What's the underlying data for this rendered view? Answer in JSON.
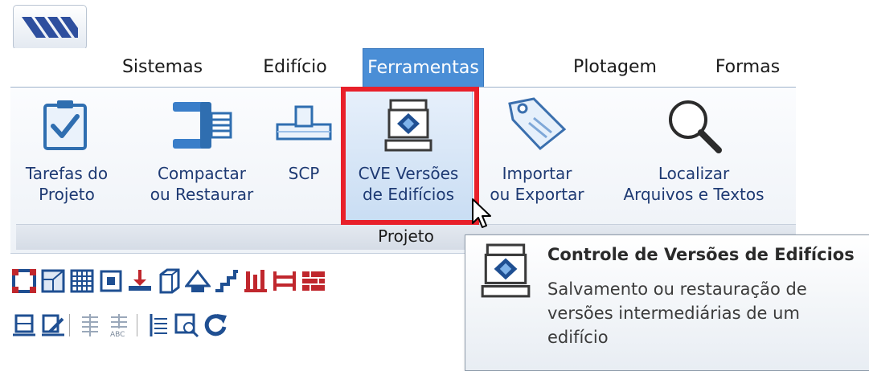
{
  "app_button": {
    "icon": "application-logo-icon"
  },
  "tabs": [
    {
      "label": "Sistemas",
      "active": false
    },
    {
      "label": "Edifício",
      "active": false
    },
    {
      "label": "Ferramentas",
      "active": true
    },
    {
      "label": "Plotagem",
      "active": false
    },
    {
      "label": "Formas",
      "active": false
    }
  ],
  "ribbon": {
    "group_label": "Projeto",
    "commands": [
      {
        "line1": "Tarefas do",
        "line2": "Projeto",
        "icon": "clipboard-check-icon"
      },
      {
        "line1": "Compactar",
        "line2": "ou Restaurar",
        "icon": "clamp-icon"
      },
      {
        "line1": "SCP",
        "line2": "",
        "icon": "pipe-tee-icon"
      },
      {
        "line1": "CVE Versões",
        "line2": "de Edifícios",
        "icon": "version-control-icon"
      },
      {
        "line1": "Importar",
        "line2": "ou Exportar",
        "icon": "tag-icon"
      },
      {
        "line1": "Localizar",
        "line2": "Arquivos e Textos",
        "icon": "magnifier-icon"
      }
    ]
  },
  "tooltip": {
    "title": "Controle de Versões de Edifícios",
    "desc_line1": "Salvamento ou restauração de",
    "desc_line2": "versões intermediárias de um",
    "desc_line3": "edifício"
  },
  "colors": {
    "active_tab": "#4a8ed6",
    "highlight_border": "#e8202a",
    "ribbon_label": "#1e3a73"
  }
}
